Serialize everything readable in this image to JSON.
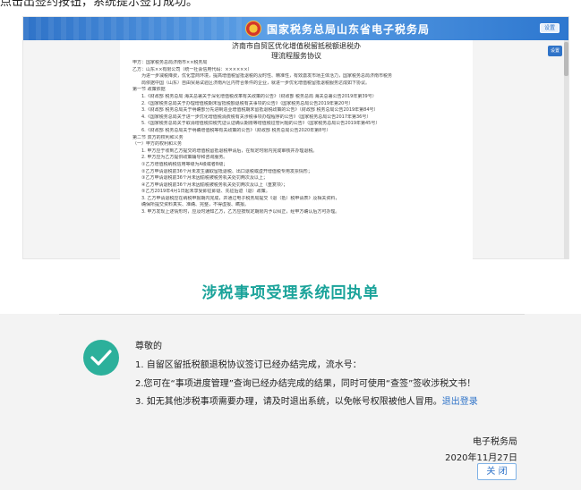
{
  "top_caption": "点击出签约按钮，系统提示签订成功。",
  "banner": {
    "title": "国家税务总局山东省电子税务局",
    "top_button": "设置",
    "side_button": "设置"
  },
  "document": {
    "title_line1": "济南市自贸区优化增值税留抵税额退税办",
    "title_line2": "理流程服务协议",
    "lines": [
      "甲方：国家税务总局济南市××税务局",
      "乙方：山东××有限公司（统一社会信用代码：××××××）",
      "为进一步减税降费，优化营商环境，提高增值税留抵退税的及时性、精准性，有效激发市场主体活力，国家税务总局济南市税务",
      "局依据中国（山东）自由贸易试验区济南片区内符合条件的企业，就进一步优化增值税留抵退税服务达成如下协议。",
      "第一节  政策依据",
      "1.《财政部 税务总局 海关总署关于深化增值税改革有关政策的公告》（财政部 税务总局 海关总署公告2019年第39号）",
      "2.《国家税务总局关于办理增值税期末留抵税额退税有关事项的公告》（国家税务总局公告2019年第20号）",
      "3.《财政部 税务总局关于明确部分先进制造业增值税期末留抵退税政策的公告》（财政部 税务总局公告2019年第84号）",
      "4.《国家税务总局关于进一步优化增值税消费税有关涉税事项办理程序的公告》（国家税务总局公告2017年第36号）",
      "5.《国家税务总局关于取消增值税扣税凭证认证确认期限等增值税征管问题的公告》（国家税务总局公告2019年第45号）",
      "6.《财政部 税务总局关于明确增值税等有关政策的公告》（财政部 税务总局公告2020年第8号）",
      "第二节  双方的权利和义务",
      "（一）甲方的权利和义务",
      "1. 甲方应于收到乙方提交的增值税留抵退税申请后，在规定时限内完成审核并办理退税。",
      "2. 甲方应为乙方提供政策辅导和咨询服务。",
      "①乙方增值税纳税信用等级为A级或者B级；",
      "②乙方申请退税前36个月未发生骗取留抵退税、出口退税或虚开增值税专用发票情形；",
      "③乙方申请退税前36个月未因偷税被税务机关处罚两次及以上；",
      "④乙方申请退税前36个月未因偷税被税务机关处罚两次及以上（重复项）；",
      "⑤乙方2019年4月1日起未享受即征即退、先征后返（退）政策。",
      "3. 乙方申请退税应在纳税申报期内完成，并通过电子税务局提交《退（抵）税申请表》及相关资料，",
      "确保所提交资料真实、准确、完整，不得虚报、瞒报。",
      "3. 甲方发现上述情形时，应及时通知乙方，乙方应按规定期限内予以纠正，经甲方确认后方可办理。"
    ]
  },
  "receipt": {
    "title": "涉税事项受理系统回执单",
    "greeting": "尊敬的",
    "item1": "1. 自留区留抵税额退税协议签订已经办结完成，流水号：",
    "item2": "2.您可在“事项进度管理”查询已经办结完成的结果，同时可使用“查签”签收涉税文书！",
    "item3_prefix": "3. 如无其他涉税事项需要办理，请及时退出系统，以免帐号权限被他人冒用。",
    "item3_link": "退出登录",
    "signature": "电子税务局",
    "date": "2020年11月27日",
    "close_button": "关 闭"
  },
  "colors": {
    "banner_blue": "#2f73c8",
    "receipt_title": "#1aa39a",
    "check_green": "#2cb09b",
    "link_blue": "#2f73c8"
  },
  "icons": {
    "success": "check-circle-icon",
    "emblem": "national-emblem-icon"
  }
}
